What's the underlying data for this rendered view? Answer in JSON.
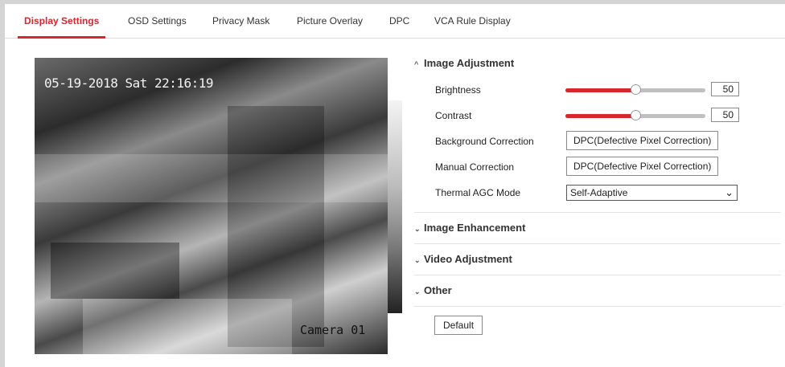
{
  "tabs": [
    {
      "label": "Display Settings",
      "active": true
    },
    {
      "label": "OSD Settings",
      "active": false
    },
    {
      "label": "Privacy Mask",
      "active": false
    },
    {
      "label": "Picture Overlay",
      "active": false
    },
    {
      "label": "DPC",
      "active": false
    },
    {
      "label": "VCA Rule Display",
      "active": false
    }
  ],
  "video": {
    "timestamp": "05-19-2018 Sat 22:16:19",
    "camera_name": "Camera 01"
  },
  "image_adjustment": {
    "title": "Image Adjustment",
    "brightness": {
      "label": "Brightness",
      "value": "50",
      "fraction": 0.5
    },
    "contrast": {
      "label": "Contrast",
      "value": "50",
      "fraction": 0.5
    },
    "background_correction": {
      "label": "Background Correction",
      "button": "DPC(Defective Pixel Correction)"
    },
    "manual_correction": {
      "label": "Manual Correction",
      "button": "DPC(Defective Pixel Correction)"
    },
    "thermal_agc": {
      "label": "Thermal AGC Mode",
      "selected": "Self-Adaptive"
    }
  },
  "sections": {
    "image_enhancement": "Image Enhancement",
    "video_adjustment": "Video Adjustment",
    "other": "Other"
  },
  "default_button": "Default",
  "colors": {
    "accent": "#d8262f"
  }
}
